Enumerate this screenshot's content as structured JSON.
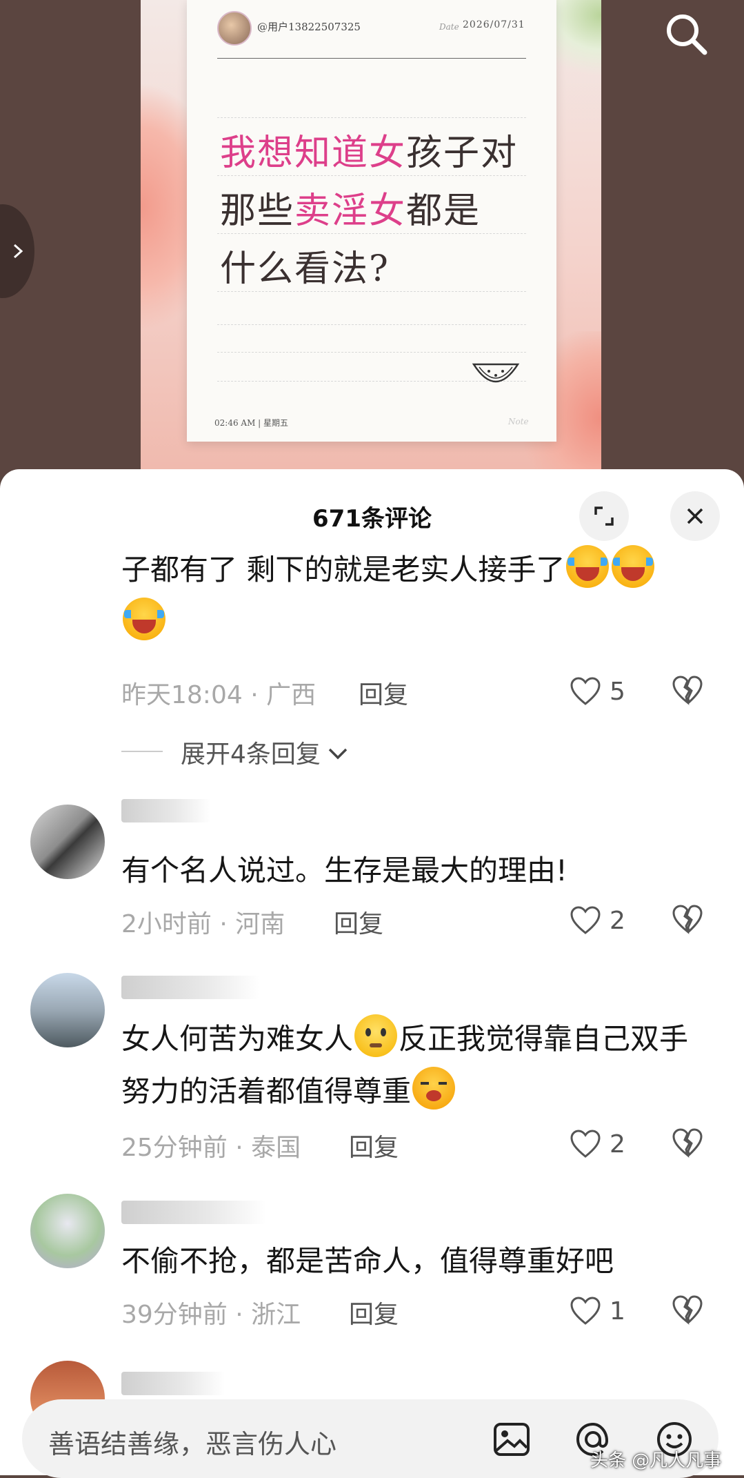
{
  "note": {
    "username": "@用户13822507325",
    "date_label": "Date",
    "date": "2026/07/31",
    "title_parts": [
      {
        "text": "我想知道女",
        "hl": true
      },
      {
        "text": "孩子对",
        "hl": false
      },
      {
        "text": "那些",
        "hl": false
      },
      {
        "text": "卖淫女",
        "hl": true
      },
      {
        "text": "都是",
        "hl": false
      },
      {
        "text": "什么看法?",
        "hl": false
      }
    ],
    "footer_left": "02:46 AM  |  星期五",
    "footer_right": "Note"
  },
  "sheet": {
    "title": "671条评论",
    "comments": [
      {
        "text": "子都有了  剩下的就是老实人接手了",
        "emojis": [
          "cry",
          "cry",
          "cry"
        ],
        "time": "昨天18:04",
        "location": "广西",
        "reply_label": "回复",
        "likes": "5",
        "expand_label": "展开4条回复"
      },
      {
        "text": "有个名人说过。生存是最大的理由!",
        "time": "2小时前",
        "location": "河南",
        "reply_label": "回复",
        "likes": "2"
      },
      {
        "text_a": "女人何苦为难女人",
        "text_b": "反正我觉得靠自己双手努力的活着都值得尊重",
        "emojis": [
          "think",
          "sleepy"
        ],
        "time": "25分钟前",
        "location": "泰国",
        "reply_label": "回复",
        "likes": "2"
      },
      {
        "text": "不偷不抢，都是苦命人，值得尊重好吧",
        "time": "39分钟前",
        "location": "浙江",
        "reply_label": "回复",
        "likes": "1"
      }
    ]
  },
  "input": {
    "placeholder": "善语结善缘，恶言伤人心"
  },
  "watermark": "头条 @凡人凡事",
  "icons": [
    "search-icon",
    "chevron-right-icon",
    "expand-icon",
    "close-icon",
    "heart-icon",
    "broken-heart-icon",
    "chevron-down-icon",
    "image-icon",
    "at-icon",
    "emoji-icon",
    "watermelon-icon"
  ],
  "colors": {
    "highlight": "#dd3f8a",
    "sheet": "#ffffff",
    "muted": "#a8a8a8"
  }
}
